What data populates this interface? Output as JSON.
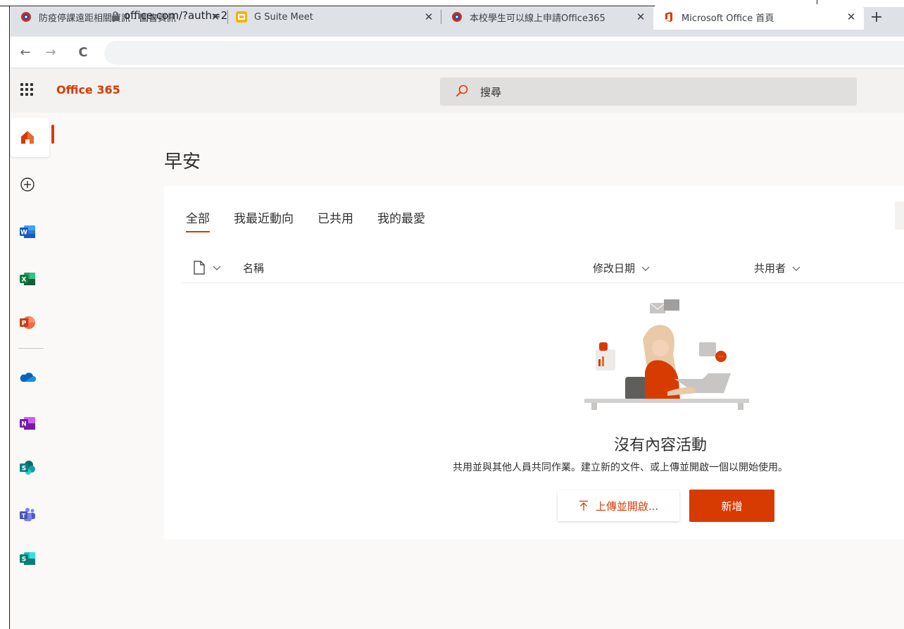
{
  "browser": {
    "tabs": [
      {
        "title": "防疫停課遠距相關資訊 - 圖書資訊",
        "close": "✕"
      },
      {
        "title": "G Suite Meet",
        "close": "✕"
      },
      {
        "title": "本校學生可以線上申請Office365",
        "close": "✕"
      },
      {
        "title": "Microsoft Office 首頁",
        "close": "✕"
      }
    ],
    "new_tab": "+",
    "back": "←",
    "forward": "→",
    "reload": "C",
    "url": "office.com/?auth=2"
  },
  "header": {
    "app_name": "Office 365",
    "search_placeholder": "搜尋"
  },
  "rail": {
    "items": [
      {
        "icon": "home-icon"
      },
      {
        "icon": "create-icon"
      },
      {
        "icon": "word-icon",
        "letter": "W",
        "color": "#185abd"
      },
      {
        "icon": "excel-icon",
        "letter": "X",
        "color": "#107c41"
      },
      {
        "icon": "powerpoint-icon",
        "letter": "P",
        "color": "#c43e1c"
      },
      {
        "icon": "onedrive-icon",
        "color": "#0364b8"
      },
      {
        "icon": "onenote-icon",
        "letter": "N",
        "color": "#7719aa"
      },
      {
        "icon": "sharepoint-icon",
        "letter": "S",
        "color": "#036c70"
      },
      {
        "icon": "teams-icon",
        "color": "#4b53bc"
      },
      {
        "icon": "sway-icon",
        "letter": "S",
        "color": "#008272"
      }
    ]
  },
  "main": {
    "greeting": "早安",
    "tabs": [
      {
        "label": "全部",
        "active": true
      },
      {
        "label": "我最近動向",
        "active": false
      },
      {
        "label": "已共用",
        "active": false
      },
      {
        "label": "我的最愛",
        "active": false
      }
    ],
    "columns": {
      "name": "名稱",
      "modified": "修改日期",
      "shared_by": "共用者"
    },
    "empty": {
      "title": "沒有內容活動",
      "subtitle": "共用並與其他人員共同作業。建立新的文件、或上傳並開啟一個以開始使用。"
    },
    "buttons": {
      "upload": "上傳並開啟...",
      "new": "新增"
    }
  },
  "colors": {
    "accent": "#d83b01",
    "header_bg": "#f3f2f1"
  }
}
